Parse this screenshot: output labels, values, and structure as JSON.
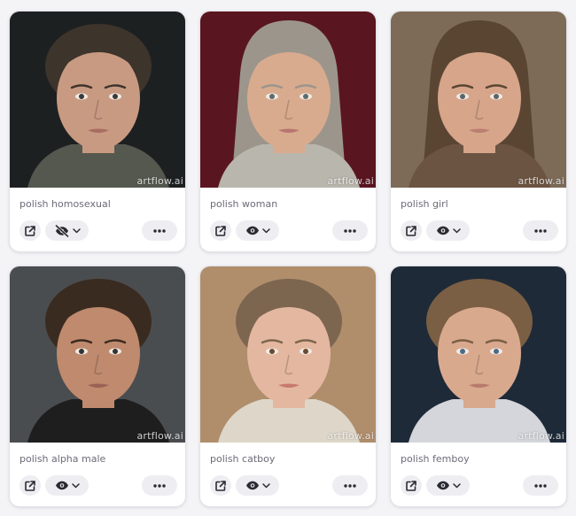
{
  "cards": [
    {
      "prompt": "polish homosexual",
      "watermark": "artflow.ai",
      "visibility": "hidden",
      "palette": {
        "bg": "#1d2021",
        "skin": "#c99a82",
        "hair": "#3d342c",
        "top": "#55584f",
        "eyes": "#3a3a3a",
        "lips": "#a86c60"
      }
    },
    {
      "prompt": "polish woman",
      "watermark": "artflow.ai",
      "visibility": "visible",
      "palette": {
        "bg": "#5a1620",
        "skin": "#d9ab8e",
        "hair": "#9c958c",
        "top": "#b9b6ad",
        "eyes": "#5c6d6e",
        "lips": "#b87670"
      }
    },
    {
      "prompt": "polish girl",
      "watermark": "artflow.ai",
      "visibility": "visible",
      "palette": {
        "bg": "#7d6b58",
        "skin": "#d6a58a",
        "hair": "#5a4532",
        "top": "#6c5442",
        "eyes": "#5a666a",
        "lips": "#bb7e72"
      }
    },
    {
      "prompt": "polish alpha male",
      "watermark": "artflow.ai",
      "visibility": "visible",
      "palette": {
        "bg": "#4a4d50",
        "skin": "#bf8a6d",
        "hair": "#3a2b20",
        "top": "#1e1e1e",
        "eyes": "#333333",
        "lips": "#9c6156"
      }
    },
    {
      "prompt": "polish catboy",
      "watermark": "artflow.ai",
      "visibility": "visible",
      "palette": {
        "bg": "#b08e6c",
        "skin": "#e4b8a0",
        "hair": "#7d6650",
        "top": "#ded7c9",
        "eyes": "#6b4a32",
        "lips": "#c87a6e"
      }
    },
    {
      "prompt": "polish femboy",
      "watermark": "artflow.ai",
      "visibility": "visible",
      "palette": {
        "bg": "#1e2a38",
        "skin": "#d9a98e",
        "hair": "#7a5f44",
        "top": "#d4d6dc",
        "eyes": "#4d6a86",
        "lips": "#b97a6e"
      }
    }
  ]
}
